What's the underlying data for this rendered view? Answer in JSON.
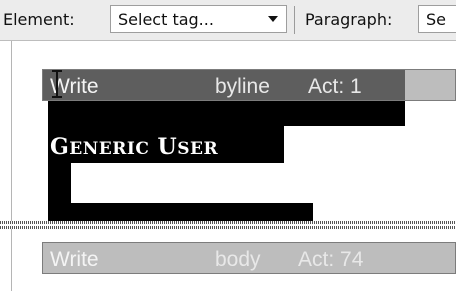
{
  "toolbar": {
    "element_label": "Element:",
    "element_select_value": "Select tag...",
    "paragraph_label": "Paragraph:",
    "paragraph_select_value": "Se"
  },
  "editor": {
    "byline_field": {
      "action": "Write",
      "tag": "byline",
      "act": "Act: 1"
    },
    "byline_text": {
      "first_initial": "G",
      "first_rest": "ENERIC",
      "last_initial": "U",
      "last_rest": "SER"
    },
    "body_field": {
      "action": "Write",
      "tag": "body",
      "act": "Act: 74"
    }
  },
  "colors": {
    "toolbar_bg": "#ececec",
    "field_tag_bg": "#bdbdbd",
    "selection_bg": "#000000"
  }
}
